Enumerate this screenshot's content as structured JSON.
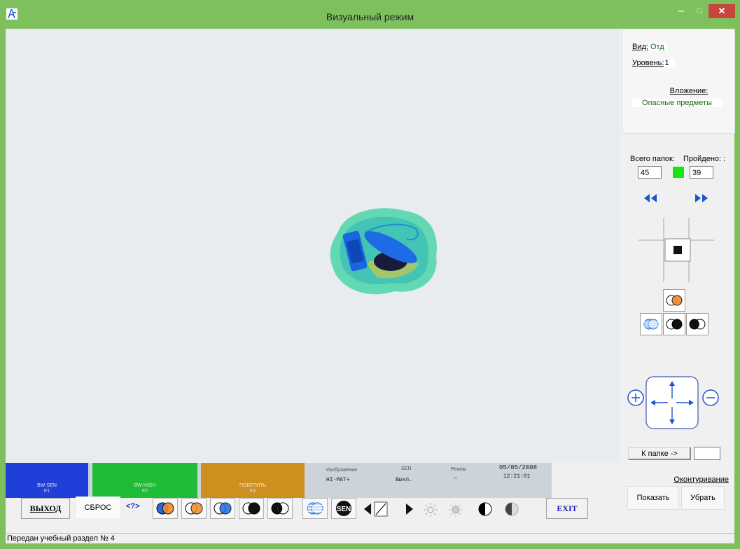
{
  "window": {
    "title": "Визуальный режим",
    "minimize": "–",
    "maximize": "□",
    "close": "✕"
  },
  "side": {
    "view_label": "Вид:",
    "view_value": "Отд",
    "level_label": "Уровень:",
    "level_value": "1",
    "attachment_label": "Вложение:",
    "attachment_value": "Опасные предметы",
    "total_label": "Всего папок:",
    "passed_label": "Пройдено: :",
    "total_value": "45",
    "passed_value": "39",
    "goto_folder_label": "К папке ->",
    "goto_folder_value": "",
    "contour_label": "Оконтуривание",
    "show_label": "Показать",
    "remove_label": "Убрать"
  },
  "monitor": {
    "mode1": "BW-SEN",
    "mode1_key": "F1",
    "mode2": "BW-HIGH",
    "mode2_key": "F2",
    "mode3": "ПОВЕТИТЬ",
    "mode3_key": "F3",
    "image_label": "Изображение",
    "image_value": "HI-MAT+",
    "sen_label": "SEN",
    "sen_value": "Выкл.",
    "mode_label": "Режим",
    "mode_value": "—",
    "date": "05/05/2008",
    "time": "12:21:01"
  },
  "toolbar": {
    "exit_ru": "ВЫХОД",
    "reset": "СБРОС",
    "help": "<?>",
    "exit_en": "EXIT",
    "sen": "SEN"
  },
  "status": {
    "text": "Передан учебный раздел № 4"
  },
  "colors": {
    "titlebar": "#7ec05e",
    "indicator": "#11e811",
    "accent_blue": "#1a4fd1"
  }
}
